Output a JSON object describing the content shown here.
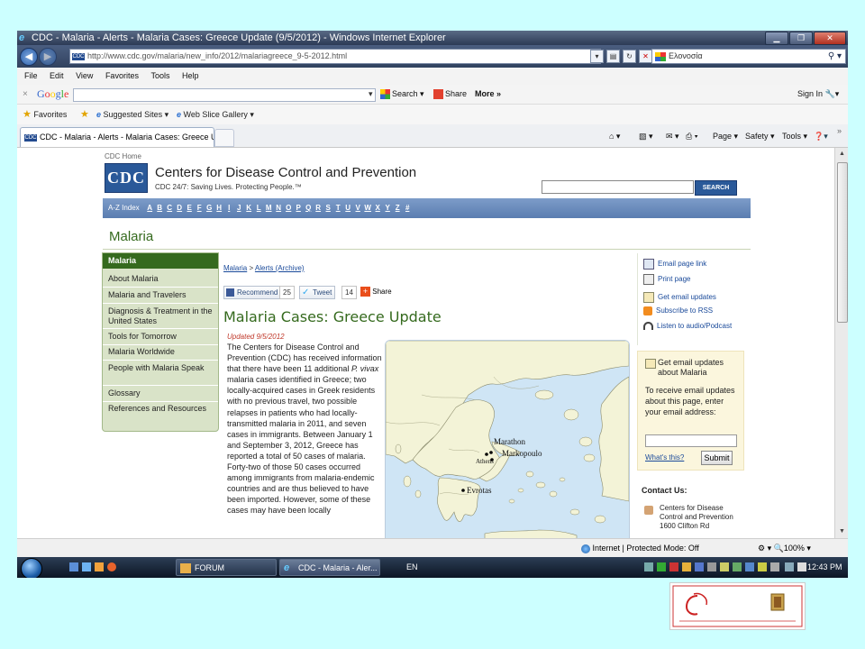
{
  "window": {
    "title": "CDC - Malaria - Alerts - Malaria Cases: Greece Update (9/5/2012) - Windows Internet Explorer",
    "url": "http://www.cdc.gov/malaria/new_info/2012/malariagreece_9-5-2012.html",
    "search_value": "Ελονοσία"
  },
  "menu": [
    "File",
    "Edit",
    "View",
    "Favorites",
    "Tools",
    "Help"
  ],
  "google_bar": {
    "logo": "Google",
    "search_label": "Search",
    "share_label": "Share",
    "more_label": "More »",
    "signin_label": "Sign In"
  },
  "favorites_bar": {
    "favorites_label": "Favorites",
    "suggested_label": "Suggested Sites",
    "webslice_label": "Web Slice Gallery"
  },
  "tab": {
    "label": "CDC - Malaria - Alerts - Malaria Cases: Greece Up..."
  },
  "command_bar": {
    "page_label": "Page",
    "safety_label": "Safety",
    "tools_label": "Tools"
  },
  "page": {
    "cdc_home": "CDC Home",
    "logo_text": "CDC",
    "org_name": "Centers for Disease Control and Prevention",
    "tagline": "CDC 24/7: Saving Lives. Protecting People.™",
    "search_button": "SEARCH",
    "az_label": "A-Z Index",
    "az_letters": [
      "A",
      "B",
      "C",
      "D",
      "E",
      "F",
      "G",
      "H",
      "I",
      "J",
      "K",
      "L",
      "M",
      "N",
      "O",
      "P",
      "Q",
      "R",
      "S",
      "T",
      "U",
      "V",
      "W",
      "X",
      "Y",
      "Z",
      "#"
    ],
    "section_title": "Malaria",
    "left_nav": {
      "header": "Malaria",
      "items": [
        "About Malaria",
        "Malaria and Travelers",
        "Diagnosis & Treatment in the United States",
        "Tools for Tomorrow",
        "Malaria Worldwide",
        "People with Malaria Speak",
        "Glossary",
        "References and Resources"
      ]
    },
    "breadcrumb": [
      "Malaria",
      "Alerts (Archive)"
    ],
    "social": {
      "recommend_label": "Recommend",
      "recommend_count": "25",
      "tweet_label": "Tweet",
      "tweet_count": "14",
      "share_label": "Share"
    },
    "article": {
      "title": "Malaria Cases: Greece Update",
      "updated": "Updated 9/5/2012",
      "body_html_parts": {
        "p1": "The Centers for Disease Control and Prevention (CDC) has received information that there have been 11 additional ",
        "italic": "P. vivax",
        "p2": " malaria cases identified in Greece; two locally-acquired cases in Greek residents with no previous travel, two possible relapses in patients who had locally-transmitted malaria in 2011, and seven cases in immigrants. Between January 1 and September 3, 2012, Greece has reported a total of 50 cases of malaria. Forty-two of those 50 cases occurred among immigrants from malaria-endemic countries and are thus believed to have been imported. However, some of these cases may have been locally"
      }
    },
    "map_labels": {
      "marathon": "Marathon",
      "markopoulo": "Markopoulo",
      "athens": "Athens",
      "evrotas": "Evrotas"
    },
    "right_links": [
      "Email page link",
      "Print page",
      "Get email updates",
      "Subscribe to RSS",
      "Listen to audio/Podcast"
    ],
    "email_box": {
      "title": "Get email updates about Malaria",
      "text": "To receive email updates about this page, enter your email address:",
      "whats_this": "What's this?",
      "submit": "Submit"
    },
    "contact": {
      "heading": "Contact Us:",
      "lines": [
        "Centers for Disease Control and Prevention",
        "1600 Clifton Rd"
      ]
    }
  },
  "status_bar": {
    "zone": "Internet | Protected Mode: Off",
    "zoom": "100%"
  },
  "taskbar": {
    "items": [
      "FORUM",
      "CDC - Malaria - Aler..."
    ],
    "lang": "EN",
    "clock": "12:43 PM"
  }
}
